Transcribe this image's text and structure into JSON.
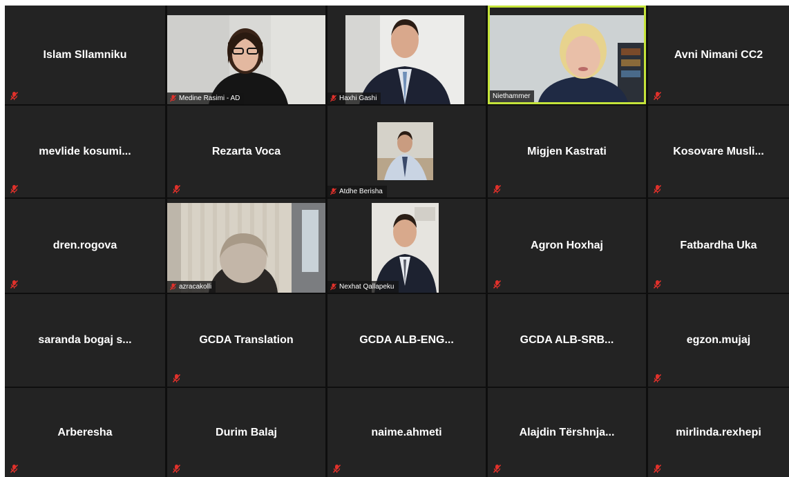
{
  "participants": [
    {
      "name": "Islam Sllamniku"
    },
    {
      "name": "Medine Rasimi - AD"
    },
    {
      "name": "Haxhi Gashi"
    },
    {
      "name": "Niethammer"
    },
    {
      "name": "Avni Nimani CC2"
    },
    {
      "name": "mevlide  kosumi..."
    },
    {
      "name": "Rezarta Voca"
    },
    {
      "name": "Atdhe Berisha"
    },
    {
      "name": "Migjen Kastrati"
    },
    {
      "name": "Kosovare  Musli..."
    },
    {
      "name": "dren.rogova"
    },
    {
      "name": "azracakolli"
    },
    {
      "name": "Nexhat Qallapeku"
    },
    {
      "name": "Agron Hoxhaj"
    },
    {
      "name": "Fatbardha Uka"
    },
    {
      "name": "saranda bogaj s..."
    },
    {
      "name": "GCDA Translation"
    },
    {
      "name": "GCDA  ALB-ENG..."
    },
    {
      "name": "GCDA  ALB-SRB..."
    },
    {
      "name": "egzon.mujaj"
    },
    {
      "name": "Arberesha"
    },
    {
      "name": "Durim Balaj"
    },
    {
      "name": "naime.ahmeti"
    },
    {
      "name": "Alajdin  Tërshnja..."
    },
    {
      "name": "mirlinda.rexhepi"
    }
  ],
  "colors": {
    "background": "#0e0e0e",
    "tile": "#232323",
    "active_speaker_border": "#c5e43a",
    "muted_icon": "#e0312b"
  }
}
